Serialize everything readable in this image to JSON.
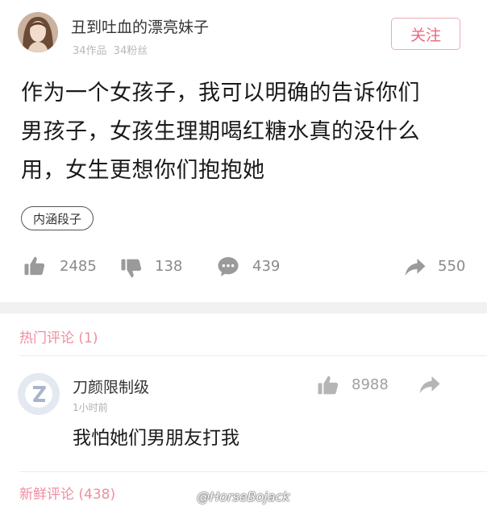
{
  "header": {
    "author_name": "丑到吐血的漂亮妹子",
    "author_stats": "34作品 34粉丝",
    "follow_label": "关注",
    "avatar_icon": "user-avatar-photo"
  },
  "post": {
    "lines": [
      "作为一个女孩子，我可以明确的告诉你们",
      "男孩子，女孩生理期喝红糖水真的没什么",
      "用，女生更想你们抱抱她"
    ],
    "tag": "内涵段子"
  },
  "actions": {
    "like_count": "2485",
    "dislike_count": "138",
    "comment_count": "439",
    "share_count": "550",
    "icons": [
      "thumbs-up-icon",
      "thumbs-down-icon",
      "comment-bubble-icon",
      "share-arrow-icon"
    ]
  },
  "hot_comments": {
    "title": "热门评论 (1)",
    "items": [
      {
        "user": "刀颜限制级",
        "time": "1小时前",
        "text": "我怕她们男朋友打我",
        "like_count": "8988"
      }
    ]
  },
  "fresh_comments": {
    "title": "新鲜评论 (438)"
  },
  "watermark": "@HorseBojack",
  "colors": {
    "accent_pink": "#e8697f",
    "section_pink": "#f08da0",
    "icon_gray": "#9a9a9a",
    "divider_gray": "#f1f1f1"
  }
}
